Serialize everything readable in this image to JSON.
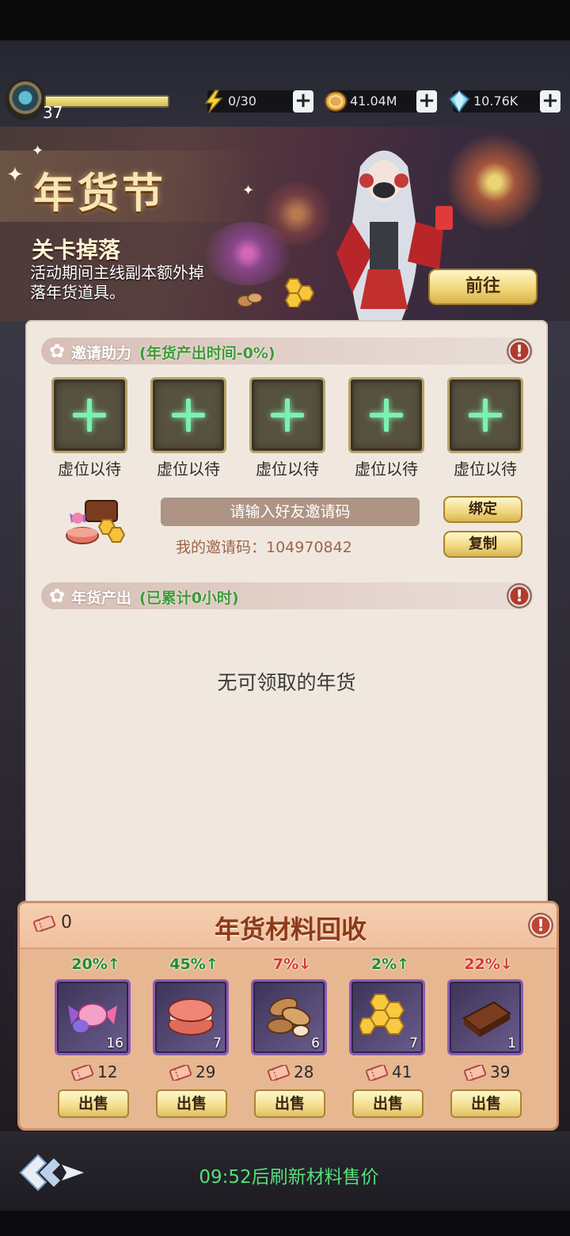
{
  "player": {
    "level": "37",
    "xp_fraction": 1.0
  },
  "resources": [
    {
      "name": "stamina",
      "icon": "lightning-icon",
      "value": "0/30"
    },
    {
      "name": "gold",
      "icon": "gold-coin-icon",
      "value": "41.04M"
    },
    {
      "name": "diamond",
      "icon": "diamond-icon",
      "value": "10.76K"
    }
  ],
  "banner": {
    "title": "年货节",
    "subtitle": "关卡掉落",
    "description": "活动期间主线副本额外掉落年货道具。",
    "goto_label": "前往"
  },
  "invite": {
    "section_title": "邀请助力",
    "section_note": "(年货产出时间-0%)",
    "slots": [
      {
        "label": "虚位以待"
      },
      {
        "label": "虚位以待"
      },
      {
        "label": "虚位以待"
      },
      {
        "label": "虚位以待"
      },
      {
        "label": "虚位以待"
      }
    ],
    "input_placeholder": "请输入好友邀请码",
    "my_code_label": "我的邀请码：104970842",
    "bind_label": "绑定",
    "copy_label": "复制"
  },
  "output": {
    "section_title": "年货产出",
    "section_note": "(已累计0小时)",
    "empty_text": "无可领取的年货"
  },
  "recycle": {
    "title": "年货材料回收",
    "ticket_count": "0",
    "items": [
      {
        "name": "candy",
        "pct": "20%↑",
        "trend": "up",
        "count": "16",
        "price": "12",
        "sell": "出售"
      },
      {
        "name": "macaron",
        "pct": "45%↑",
        "trend": "up",
        "count": "7",
        "price": "29",
        "sell": "出售"
      },
      {
        "name": "almond",
        "pct": "7%↓",
        "trend": "down",
        "count": "6",
        "price": "28",
        "sell": "出售"
      },
      {
        "name": "honeycomb",
        "pct": "2%↑",
        "trend": "up",
        "count": "7",
        "price": "41",
        "sell": "出售"
      },
      {
        "name": "chocolate",
        "pct": "22%↓",
        "trend": "down",
        "count": "1",
        "price": "39",
        "sell": "出售"
      }
    ]
  },
  "footer": {
    "refresh_text": "09:52后刷新材料售价"
  },
  "colors": {
    "accent_green": "#53e07a",
    "up": "#1f8d2c",
    "down": "#d43a2a",
    "panel": "#f0e8df"
  }
}
